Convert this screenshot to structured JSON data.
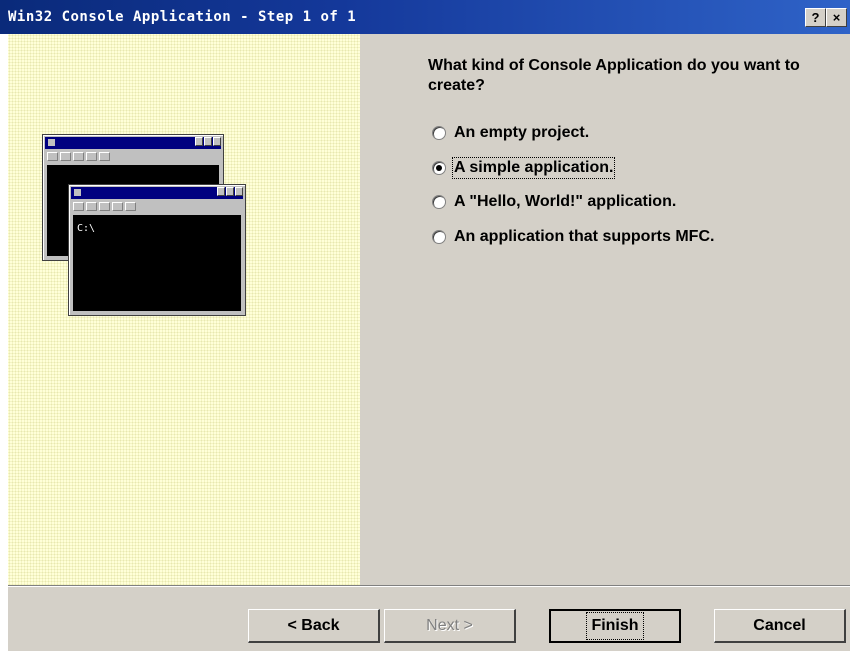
{
  "window": {
    "title": "Win32 Console Application - Step 1 of 1",
    "help_button": "?",
    "close_button": "×"
  },
  "wizard": {
    "question": "What kind of Console Application do you want to create?",
    "options": [
      {
        "label": "An empty project.",
        "checked": false
      },
      {
        "label": "A simple application.",
        "checked": true
      },
      {
        "label": "A \"Hello, World!\" application.",
        "checked": false
      },
      {
        "label": "An application that supports MFC.",
        "checked": false
      }
    ]
  },
  "illustration": {
    "prompt_text": "C:\\"
  },
  "buttons": {
    "back": "< Back",
    "next": "Next >",
    "finish": "Finish",
    "cancel": "Cancel"
  }
}
